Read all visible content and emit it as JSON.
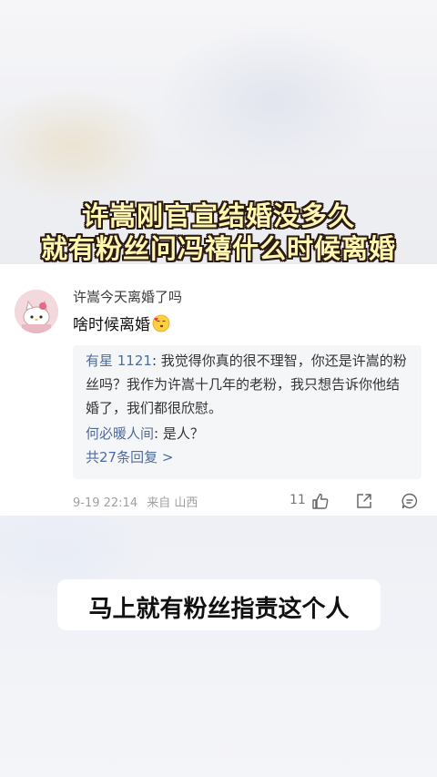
{
  "headline": {
    "line1": "许嵩刚官宣结婚没多久",
    "line2": "就有粉丝问冯禧什么时候离婚"
  },
  "comment": {
    "username": "许嵩今天离婚了吗",
    "text": "啥时候离婚",
    "emoji": "kissing-face-emoji",
    "replies": [
      {
        "author": "有星 1121",
        "text": ": 我觉得你真的很不理智，你还是许嵩的粉丝吗？我作为许嵩十几年的老粉，我只想告诉你他结婚了，我们都很欣慰。"
      },
      {
        "author": "何必暖人间",
        "text": ": 是人？"
      }
    ],
    "more_replies": "共27条回复 >",
    "date": "9-19 22:14",
    "location": "来自 山西",
    "likes": "11"
  },
  "caption": "马上就有粉丝指责这个人",
  "colors": {
    "headline_fill": "#fff6b0",
    "headline_outline": "#2b1a12",
    "link_blue": "#4f6c9e",
    "meta_gray": "#a0a0a0"
  }
}
